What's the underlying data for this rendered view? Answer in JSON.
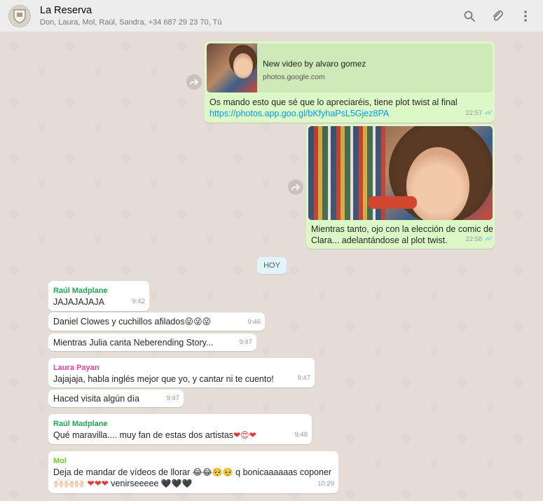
{
  "header": {
    "title": "La Reserva",
    "participants": "Don, Laura, Mol, Raúl, Sandra, +34 687 29 23 70, Tú"
  },
  "colors": {
    "outgoing_bubble": "#dcf8c6",
    "incoming_bubble": "#ffffff",
    "chat_bg": "#e5ddd5",
    "link": "#039be5",
    "ticks": "#4fc3f7"
  },
  "messages": {
    "m1": {
      "preview_title": "New video by alvaro gomez",
      "preview_domain": "photos.google.com",
      "text": "Os mando esto que sé que lo apreciaréis, tiene plot twist al final",
      "link": "https://photos.app.goo.gl/bKfyhaPsL5Gjez8PA",
      "time": "22:57"
    },
    "m2": {
      "text_line1": "Mientras tanto, ojo con la elección de comic de",
      "text_line2": "Clara... adelantándose al plot twist.",
      "time": "22:58"
    },
    "day": "HOY",
    "m3": {
      "sender": "Raúl Madplane",
      "sender_color": "#1fa855",
      "text": "JAJAJAJAJA",
      "time": "9:42"
    },
    "m4": {
      "text": "Daniel Clowes y cuchillos afilados",
      "emoji": "😜😜😜",
      "time": "9:46"
    },
    "m5": {
      "text": "Mientras Julia canta Neberending Story...",
      "time": "9:47"
    },
    "m6": {
      "sender": "Laura Payan",
      "sender_color": "#e542a3",
      "text": "Jajajaja, habla inglés mejor que yo, y cantar ni te cuento!",
      "time": "9:47"
    },
    "m7": {
      "text": "Haced visita algún día",
      "time": "9:47"
    },
    "m8": {
      "sender": "Raúl Madplane",
      "sender_color": "#1fa855",
      "text": "Qué maravilla.... muy fan de estas dos artistas",
      "emoji": "❤😍❤",
      "time": "9:48"
    },
    "m9": {
      "sender": "Mol",
      "sender_color": "#6bcb2f",
      "text_line1": "Deja de mandar de vídeos de llorar ",
      "emoji1": "😂😂🥺🥺",
      "text_line1b": " q bonicaaaaaas coponer",
      "emoji2a": "🙌🏻🙌🏻🙌🏻 ❤❤❤",
      "text_line2": " venirseeeee ",
      "emoji2b": "🖤🖤🖤",
      "time": "10:29"
    }
  }
}
